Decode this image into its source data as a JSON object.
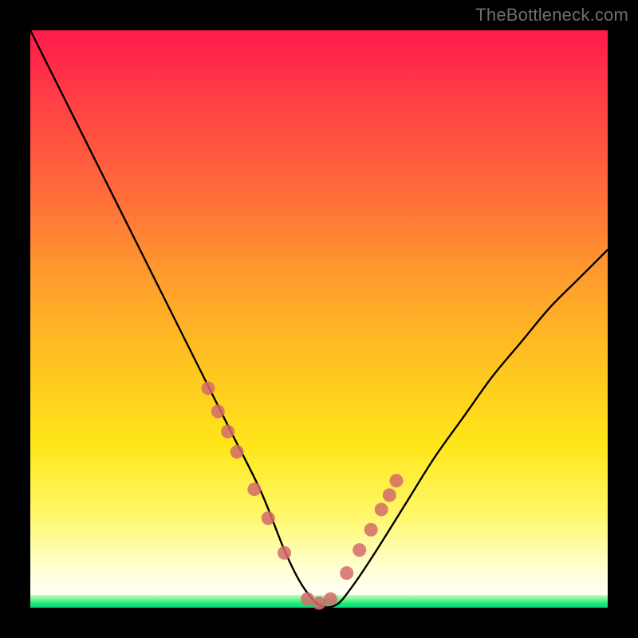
{
  "watermark": "TheBottleneck.com",
  "chart_data": {
    "type": "line",
    "title": "",
    "xlabel": "",
    "ylabel": "",
    "xlim": [
      0,
      100
    ],
    "ylim": [
      0,
      100
    ],
    "grid": false,
    "legend": false,
    "series": [
      {
        "name": "bottleneck-curve",
        "x": [
          0,
          5,
          10,
          15,
          20,
          25,
          30,
          35,
          40,
          44,
          47,
          50,
          53,
          56,
          60,
          65,
          70,
          75,
          80,
          85,
          90,
          95,
          100
        ],
        "y": [
          100,
          90,
          80,
          70,
          60,
          50,
          40,
          30,
          20,
          10,
          4,
          0.5,
          0.5,
          4,
          10,
          18,
          26,
          33,
          40,
          46,
          52,
          57,
          62
        ]
      }
    ],
    "markers": {
      "name": "highlighted-points",
      "color": "#d46a6a",
      "x": [
        30.8,
        32.5,
        34.2,
        35.8,
        38.8,
        41.2,
        44.0,
        48.0,
        50.0,
        52.0,
        54.8,
        57.0,
        59.0,
        60.8,
        62.2,
        63.4
      ],
      "y": [
        38.0,
        34.0,
        30.5,
        27.0,
        20.5,
        15.5,
        9.5,
        1.5,
        0.8,
        1.5,
        6.0,
        10.0,
        13.5,
        17.0,
        19.5,
        22.0
      ]
    },
    "gradient_stops": [
      {
        "pos": 0,
        "color": "#ff1a4b"
      },
      {
        "pos": 12,
        "color": "#ff3f45"
      },
      {
        "pos": 28,
        "color": "#ff6b3a"
      },
      {
        "pos": 42,
        "color": "#ff9a2e"
      },
      {
        "pos": 58,
        "color": "#ffc421"
      },
      {
        "pos": 72,
        "color": "#ffe61a"
      },
      {
        "pos": 84,
        "color": "#fff86a"
      },
      {
        "pos": 93,
        "color": "#ffffd0"
      },
      {
        "pos": 97,
        "color": "#fffff2"
      },
      {
        "pos": 100,
        "color": "#ffffff"
      }
    ]
  }
}
